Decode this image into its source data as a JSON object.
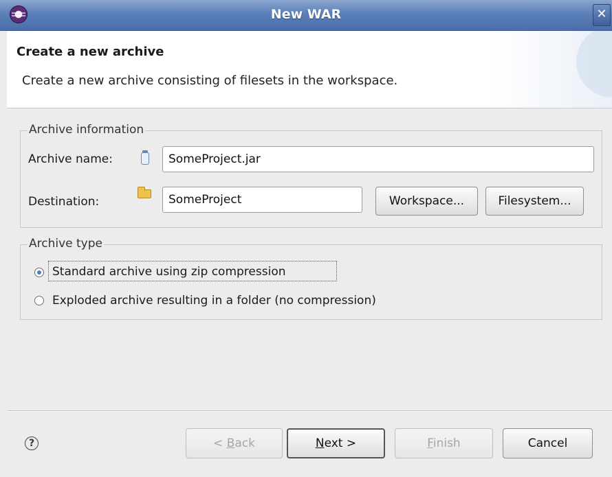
{
  "window": {
    "title": "New WAR",
    "close_glyph": "✕",
    "icon": "eclipse-icon"
  },
  "header": {
    "title": "Create a new archive",
    "description": "Create a new archive consisting of filesets in the workspace."
  },
  "archive_info": {
    "legend": "Archive information",
    "name_label": "Archive name:",
    "name_value": "SomeProject.jar",
    "destination_label": "Destination:",
    "destination_value": "SomeProject",
    "workspace_button": "Workspace...",
    "filesystem_button": "Filesystem..."
  },
  "archive_type": {
    "legend": "Archive type",
    "options": [
      {
        "label": "Standard archive using zip compression",
        "checked": true
      },
      {
        "label": "Exploded archive resulting in a folder (no compression)",
        "checked": false
      }
    ]
  },
  "footer": {
    "help_glyph": "?",
    "back": {
      "prefix": "< ",
      "mnemonic": "B",
      "rest": "ack",
      "enabled": false
    },
    "next": {
      "mnemonic": "N",
      "rest": "ext >",
      "enabled": true
    },
    "finish": {
      "mnemonic": "F",
      "rest": "inish",
      "enabled": false
    },
    "cancel": "Cancel"
  },
  "colors": {
    "titlebar": "#5b7fb8",
    "dialog_bg": "#ececec",
    "radio_dot": "#4a7fc1"
  }
}
